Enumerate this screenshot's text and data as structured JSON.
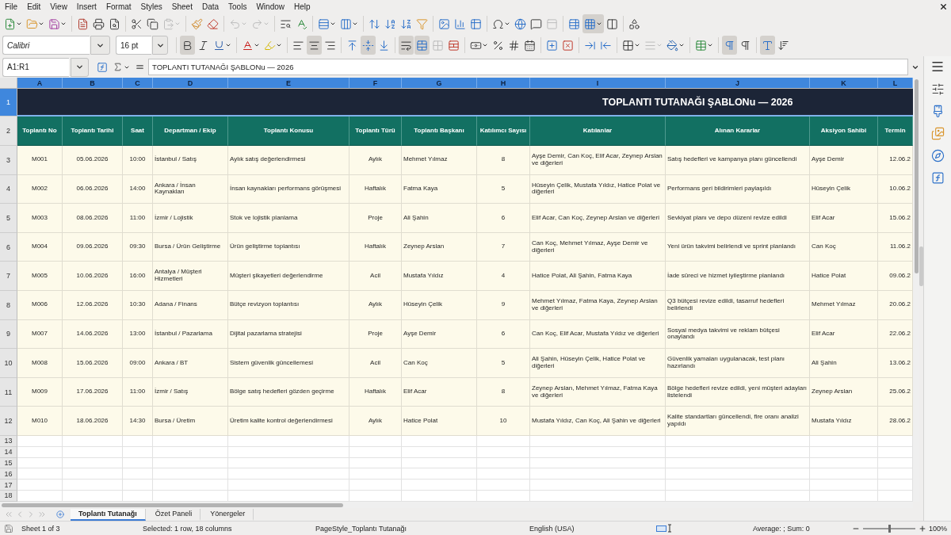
{
  "menu_bar": {
    "items": [
      "File",
      "Edit",
      "View",
      "Insert",
      "Format",
      "Styles",
      "Sheet",
      "Data",
      "Tools",
      "Window",
      "Help"
    ]
  },
  "standard_toolbar": {
    "groups": [
      [
        {
          "kind": "new",
          "dropdown": true,
          "active": false,
          "disabled": false
        },
        {
          "kind": "open",
          "dropdown": true,
          "active": false,
          "disabled": false
        },
        {
          "kind": "save",
          "dropdown": true,
          "active": false,
          "disabled": false
        }
      ],
      [
        {
          "kind": "export_pdf",
          "dropdown": false,
          "active": false,
          "disabled": false
        },
        {
          "kind": "print",
          "dropdown": false,
          "active": false,
          "disabled": false
        },
        {
          "kind": "print_preview",
          "dropdown": false,
          "active": false,
          "disabled": false
        }
      ],
      [
        {
          "kind": "cut",
          "dropdown": false,
          "active": false,
          "disabled": false
        },
        {
          "kind": "copy",
          "dropdown": false,
          "active": false,
          "disabled": false
        },
        {
          "kind": "paste",
          "dropdown": true,
          "active": false,
          "disabled": true
        }
      ],
      [
        {
          "kind": "clone_formatting",
          "dropdown": false,
          "active": false,
          "disabled": false
        },
        {
          "kind": "clear_formatting",
          "dropdown": false,
          "active": false,
          "disabled": false
        }
      ],
      [
        {
          "kind": "undo",
          "dropdown": true,
          "active": false,
          "disabled": true
        },
        {
          "kind": "redo",
          "dropdown": true,
          "active": false,
          "disabled": true
        }
      ],
      [
        {
          "kind": "find_replace",
          "dropdown": false,
          "active": false,
          "disabled": false
        },
        {
          "kind": "spelling",
          "dropdown": false,
          "active": false,
          "disabled": false
        }
      ],
      [
        {
          "kind": "row",
          "dropdown": true,
          "active": false,
          "disabled": false
        },
        {
          "kind": "column",
          "dropdown": true,
          "active": false,
          "disabled": false
        }
      ],
      [
        {
          "kind": "sort",
          "dropdown": false,
          "active": false,
          "disabled": false
        },
        {
          "kind": "sort_ascending",
          "dropdown": false,
          "active": false,
          "disabled": false
        },
        {
          "kind": "sort_descending",
          "dropdown": false,
          "active": false,
          "disabled": false
        },
        {
          "kind": "autofilter",
          "dropdown": false,
          "active": false,
          "disabled": false
        }
      ],
      [
        {
          "kind": "image",
          "dropdown": false,
          "active": false,
          "disabled": false
        },
        {
          "kind": "chart",
          "dropdown": false,
          "active": false,
          "disabled": false
        },
        {
          "kind": "pivot_table",
          "dropdown": false,
          "active": false,
          "disabled": false
        }
      ],
      [
        {
          "kind": "special_character",
          "dropdown": true,
          "active": false,
          "disabled": false
        },
        {
          "kind": "hyperlink",
          "dropdown": false,
          "active": false,
          "disabled": false
        },
        {
          "kind": "comment",
          "dropdown": false,
          "active": false,
          "disabled": false
        },
        {
          "kind": "header_footer",
          "dropdown": false,
          "active": false,
          "disabled": true
        }
      ],
      [
        {
          "kind": "print_area",
          "dropdown": false,
          "active": false,
          "disabled": false
        },
        {
          "kind": "freeze",
          "dropdown": true,
          "active": true,
          "disabled": false
        },
        {
          "kind": "split_window",
          "dropdown": false,
          "active": false,
          "disabled": false
        }
      ],
      [
        {
          "kind": "shapes",
          "dropdown": false,
          "active": false,
          "disabled": false
        }
      ]
    ]
  },
  "formatting_toolbar": {
    "font_name": "Calibri",
    "font_size": "16 pt",
    "groups": [
      [
        {
          "kind": "bold",
          "dropdown": false,
          "active": true,
          "disabled": false
        },
        {
          "kind": "italic",
          "dropdown": false,
          "active": false,
          "disabled": false
        },
        {
          "kind": "underline",
          "dropdown": true,
          "active": false,
          "disabled": false
        }
      ],
      [
        {
          "kind": "font_color",
          "dropdown": true,
          "active": false,
          "disabled": false
        },
        {
          "kind": "highlight",
          "dropdown": true,
          "active": false,
          "disabled": false
        }
      ],
      [
        {
          "kind": "align_left",
          "dropdown": false,
          "active": false,
          "disabled": false
        },
        {
          "kind": "align_center",
          "dropdown": false,
          "active": true,
          "disabled": false
        },
        {
          "kind": "align_right",
          "dropdown": false,
          "active": false,
          "disabled": false
        }
      ],
      [
        {
          "kind": "align_top",
          "dropdown": false,
          "active": false,
          "disabled": false
        },
        {
          "kind": "align_middle",
          "dropdown": false,
          "active": true,
          "disabled": false
        },
        {
          "kind": "align_bottom",
          "dropdown": false,
          "active": false,
          "disabled": false
        }
      ],
      [
        {
          "kind": "wrap",
          "dropdown": false,
          "active": true,
          "disabled": false
        },
        {
          "kind": "merge_center",
          "dropdown": false,
          "active": true,
          "disabled": false
        },
        {
          "kind": "merge",
          "dropdown": false,
          "active": false,
          "disabled": true
        },
        {
          "kind": "unmerge",
          "dropdown": false,
          "active": false,
          "disabled": false
        }
      ],
      [
        {
          "kind": "currency",
          "dropdown": true,
          "active": false,
          "disabled": false
        },
        {
          "kind": "percent",
          "dropdown": false,
          "active": false,
          "disabled": false
        },
        {
          "kind": "number",
          "dropdown": false,
          "active": false,
          "disabled": false
        },
        {
          "kind": "date",
          "dropdown": false,
          "active": false,
          "disabled": false
        }
      ],
      [
        {
          "kind": "add_decimal",
          "dropdown": false,
          "active": false,
          "disabled": false
        },
        {
          "kind": "delete_decimal",
          "dropdown": false,
          "active": false,
          "disabled": false
        }
      ],
      [
        {
          "kind": "indent_increase",
          "dropdown": false,
          "active": false,
          "disabled": false
        },
        {
          "kind": "indent_decrease",
          "dropdown": false,
          "active": false,
          "disabled": false
        }
      ],
      [
        {
          "kind": "borders",
          "dropdown": true,
          "active": false,
          "disabled": false
        },
        {
          "kind": "border_style",
          "dropdown": true,
          "active": false,
          "disabled": true
        },
        {
          "kind": "border_color",
          "dropdown": true,
          "active": false,
          "disabled": false
        }
      ],
      [
        {
          "kind": "conditional",
          "dropdown": true,
          "active": false,
          "disabled": false
        }
      ],
      [
        {
          "kind": "ltr",
          "dropdown": false,
          "active": true,
          "disabled": false
        },
        {
          "kind": "rtl",
          "dropdown": false,
          "active": false,
          "disabled": false
        }
      ],
      [
        {
          "kind": "text_horizontal",
          "dropdown": false,
          "active": true,
          "disabled": false
        },
        {
          "kind": "text_vertical",
          "dropdown": false,
          "active": false,
          "disabled": false
        }
      ]
    ]
  },
  "formula_bar": {
    "name_box": "A1:R1",
    "formula": "TOPLANTI TUTANAĞI ŞABLONu — 2026"
  },
  "sheet": {
    "column_letters": [
      {
        "label": "A",
        "selected": true
      },
      {
        "label": "B",
        "selected": true
      },
      {
        "label": "C",
        "selected": true
      },
      {
        "label": "D",
        "selected": true
      },
      {
        "label": "E",
        "selected": true
      },
      {
        "label": "F",
        "selected": true
      },
      {
        "label": "G",
        "selected": true
      },
      {
        "label": "H",
        "selected": true
      },
      {
        "label": "I",
        "selected": true
      },
      {
        "label": "J",
        "selected": true
      },
      {
        "label": "K",
        "selected": true
      },
      {
        "label": "L",
        "selected": true
      }
    ],
    "title_row": {
      "number": "1",
      "selected": true,
      "title": "TOPLANTI TUTANAĞI ŞABLONu — 2026"
    },
    "header_row": {
      "number": "2",
      "selected": false,
      "columns": [
        "Toplantı No",
        "Toplantı Tarihi",
        "Saat",
        "Departman / Ekip",
        "Toplantı Konusu",
        "Toplantı Türü",
        "Toplantı Başkanı",
        "Katılımcı Sayısı",
        "Katılanlar",
        "Alınan Kararlar",
        "Aksiyon Sahibi",
        "Termin"
      ]
    },
    "rows": [
      {
        "number": "3",
        "selected": false,
        "cells": [
          "M001",
          "05.06.2026",
          "10:00",
          "İstanbul / Satış",
          "Aylık satış değerlendirmesi",
          "Aylık",
          "Mehmet Yılmaz",
          "8",
          "Ayşe Demir, Can Koç, Elif Acar, Zeynep Arslan ve diğerleri",
          "Satış hedefleri ve kampanya planı güncellendi",
          "Ayşe Demir",
          "12.06.2"
        ]
      },
      {
        "number": "4",
        "selected": false,
        "cells": [
          "M002",
          "06.06.2026",
          "14:00",
          "Ankara / İnsan Kaynakları",
          "İnsan kaynakları performans görüşmesi",
          "Haftalık",
          "Fatma Kaya",
          "5",
          "Hüseyin Çelik, Mustafa Yıldız, Hatice Polat ve diğerleri",
          "Performans geri bildirimleri paylaşıldı",
          "Hüseyin Çelik",
          "10.06.2"
        ]
      },
      {
        "number": "5",
        "selected": false,
        "cells": [
          "M003",
          "08.06.2026",
          "11:00",
          "İzmir / Lojistik",
          "Stok ve lojistik planlama",
          "Proje",
          "Ali Şahin",
          "6",
          "Elif Acar, Can Koç, Zeynep Arslan ve diğerleri",
          "Sevkiyat planı ve depo düzeni revize edildi",
          "Elif Acar",
          "15.06.2"
        ]
      },
      {
        "number": "6",
        "selected": false,
        "cells": [
          "M004",
          "09.06.2026",
          "09:30",
          "Bursa / Ürün Geliştirme",
          "Ürün geliştirme toplantısı",
          "Haftalık",
          "Zeynep Arslan",
          "7",
          "Can Koç, Mehmet Yılmaz, Ayşe Demir ve diğerleri",
          "Yeni ürün takvimi belirlendi ve sprint planlandı",
          "Can Koç",
          "11.06.2"
        ]
      },
      {
        "number": "7",
        "selected": false,
        "cells": [
          "M005",
          "10.06.2026",
          "16:00",
          "Antalya / Müşteri Hizmetleri",
          "Müşteri şikayetleri değerlendirme",
          "Acil",
          "Mustafa Yıldız",
          "4",
          "Hatice Polat, Ali Şahin, Fatma Kaya",
          "İade süreci ve hizmet iyileştirme planlandı",
          "Hatice Polat",
          "09.06.2"
        ]
      },
      {
        "number": "8",
        "selected": false,
        "cells": [
          "M006",
          "12.06.2026",
          "10:30",
          "Adana / Finans",
          "Bütçe revizyon toplantısı",
          "Aylık",
          "Hüseyin Çelik",
          "9",
          "Mehmet Yılmaz, Fatma Kaya, Zeynep Arslan ve diğerleri",
          "Q3 bütçesi revize edildi, tasarruf hedefleri belirlendi",
          "Mehmet Yılmaz",
          "20.06.2"
        ]
      },
      {
        "number": "9",
        "selected": false,
        "cells": [
          "M007",
          "14.06.2026",
          "13:00",
          "İstanbul / Pazarlama",
          "Dijital pazarlama stratejisi",
          "Proje",
          "Ayşe Demir",
          "6",
          "Can Koç, Elif Acar, Mustafa Yıldız ve diğerleri",
          "Sosyal medya takvimi ve reklam bütçesi onaylandı",
          "Elif Acar",
          "22.06.2"
        ]
      },
      {
        "number": "10",
        "selected": false,
        "cells": [
          "M008",
          "15.06.2026",
          "09:00",
          "Ankara / BT",
          "Sistem güvenlik güncellemesi",
          "Acil",
          "Can Koç",
          "5",
          "Ali Şahin, Hüseyin Çelik, Hatice Polat ve diğerleri",
          "Güvenlik yamaları uygulanacak, test planı hazırlandı",
          "Ali Şahin",
          "13.06.2"
        ]
      },
      {
        "number": "11",
        "selected": false,
        "cells": [
          "M009",
          "17.06.2026",
          "11:00",
          "İzmir / Satış",
          "Bölge satış hedefleri gözden geçirme",
          "Haftalık",
          "Elif Acar",
          "8",
          "Zeynep Arslan, Mehmet Yılmaz, Fatma Kaya ve diğerleri",
          "Bölge hedefleri revize edildi, yeni müşteri adayları listelendi",
          "Zeynep Arslan",
          "25.06.2"
        ]
      },
      {
        "number": "12",
        "selected": false,
        "cells": [
          "M010",
          "18.06.2026",
          "14:30",
          "Bursa / Üretim",
          "Üretim kalite kontrol değerlendirmesi",
          "Aylık",
          "Hatice Polat",
          "10",
          "Mustafa Yıldız, Can Koç, Ali Şahin ve diğerleri",
          "Kalite standartları güncellendi, fire oranı analizi yapıldı",
          "Mustafa Yıldız",
          "28.06.2"
        ]
      }
    ],
    "empty_rows": [
      {
        "number": "13",
        "selected": false
      },
      {
        "number": "14",
        "selected": false
      },
      {
        "number": "15",
        "selected": false
      },
      {
        "number": "16",
        "selected": false
      },
      {
        "number": "17",
        "selected": false
      },
      {
        "number": "18",
        "selected": false
      }
    ]
  },
  "sheet_navigation": [
    {
      "kind": "first",
      "disabled": true
    },
    {
      "kind": "previous",
      "disabled": true
    },
    {
      "kind": "next",
      "disabled": true
    },
    {
      "kind": "last",
      "disabled": true
    }
  ],
  "sheet_tabs": [
    {
      "label": "Toplantı Tutanağı",
      "selected": true
    },
    {
      "label": "Özet Paneli",
      "selected": false
    },
    {
      "label": "Yönergeler",
      "selected": false
    }
  ],
  "status_bar": {
    "sheet_position": "Sheet 1 of 3",
    "selection": "Selected: 1 row, 18 columns",
    "page_style": "PageStyle_Toplantı Tutanağı",
    "language": "English (USA)",
    "summary": "Average: ; Sum: 0",
    "zoom_slider": {
      "level": 0.5
    },
    "zoom": "100%"
  }
}
